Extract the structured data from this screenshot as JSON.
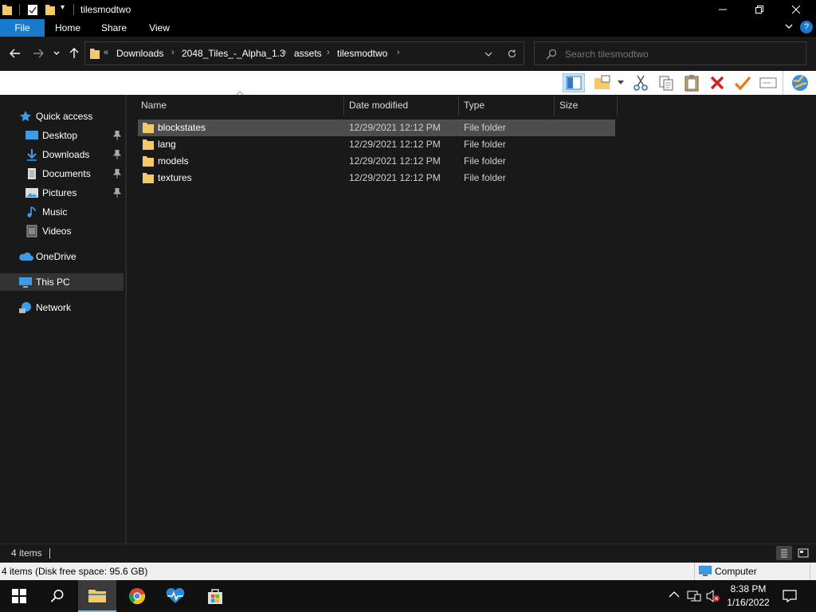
{
  "window": {
    "title": "tilesmodtwo"
  },
  "ribbon": {
    "tabs": [
      "File",
      "Home",
      "Share",
      "View"
    ]
  },
  "address": {
    "overflow": "«",
    "breadcrumbs": [
      "Downloads",
      "2048_Tiles_-_Alpha_1.3",
      "assets",
      "tilesmodtwo"
    ]
  },
  "search": {
    "placeholder": "Search tilesmodtwo"
  },
  "sidebar": {
    "items": [
      {
        "label": "Quick access",
        "icon": "star-icon",
        "pinned": false
      },
      {
        "label": "Desktop",
        "icon": "desktop-icon",
        "pinned": true
      },
      {
        "label": "Downloads",
        "icon": "download-icon",
        "pinned": true
      },
      {
        "label": "Documents",
        "icon": "documents-icon",
        "pinned": true
      },
      {
        "label": "Pictures",
        "icon": "pictures-icon",
        "pinned": true
      },
      {
        "label": "Music",
        "icon": "music-icon",
        "pinned": false
      },
      {
        "label": "Videos",
        "icon": "videos-icon",
        "pinned": false
      },
      {
        "label": "OneDrive",
        "icon": "cloud-icon",
        "pinned": false
      },
      {
        "label": "This PC",
        "icon": "computer-icon",
        "pinned": false
      },
      {
        "label": "Network",
        "icon": "network-icon",
        "pinned": false
      }
    ]
  },
  "columns": {
    "name": "Name",
    "date": "Date modified",
    "type": "Type",
    "size": "Size"
  },
  "files": [
    {
      "name": "blockstates",
      "date": "12/29/2021 12:12 PM",
      "type": "File folder",
      "selected": true
    },
    {
      "name": "lang",
      "date": "12/29/2021 12:12 PM",
      "type": "File folder",
      "selected": false
    },
    {
      "name": "models",
      "date": "12/29/2021 12:12 PM",
      "type": "File folder",
      "selected": false
    },
    {
      "name": "textures",
      "date": "12/29/2021 12:12 PM",
      "type": "File folder",
      "selected": false
    }
  ],
  "status": {
    "item_count": "4 items",
    "disk_info": "4 items (Disk free space: 95.6 GB)",
    "location": "Computer"
  },
  "clock": {
    "time": "8:38 PM",
    "date": "1/16/2022"
  },
  "colors": {
    "accent": "#1979ca",
    "selection": "#4d4d4d",
    "folder": "#f3c969"
  }
}
